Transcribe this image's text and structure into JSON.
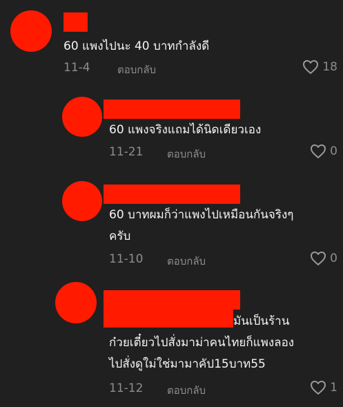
{
  "comments": [
    {
      "text_lines": [
        "60 แพงไปนะ 40 บาทกำลังดี"
      ],
      "date": "11-4",
      "reply_label": "ตอบกลับ",
      "likes": "18"
    },
    {
      "text_lines": [
        "60 แพงจริงแถมได้นิดเดียวเอง"
      ],
      "date": "11-21",
      "reply_label": "ตอบกลับ",
      "likes": "0"
    },
    {
      "text_lines": [
        "60 บาทผมก็ว่าแพงไปเหมือนกันจริงๆ",
        "ครับ"
      ],
      "date": "11-10",
      "reply_label": "ตอบกลับ",
      "likes": "0"
    },
    {
      "text_lines": [
        "มันเป็นร้าน",
        "ก๋วยเตี๋ยวไปสั่งมาม่าคนไทยก็แพงลอง",
        "ไปสั่งดูใม่ใช่มามาคัป15บาท55"
      ],
      "date": "11-12",
      "reply_label": "ตอบกลับ",
      "likes": "1"
    }
  ],
  "colors": {
    "background": "#202020",
    "redaction": "#ff1a00",
    "text": "#f4f4f4",
    "muted": "#8d8d8d"
  },
  "icons": {
    "like": "heart-outline-icon"
  }
}
